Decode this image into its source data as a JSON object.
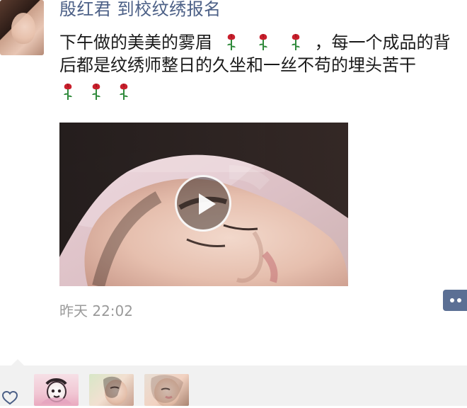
{
  "post": {
    "username": "殷红君 到校纹绣报名",
    "text_line1_before": "下午做的美美的雾眉",
    "text_line1_after": "，每一个成品的背",
    "text_line2": "后都是纹绣师整日的久坐和一丝不苟的埋头苦干",
    "emoji_name": "rose-emoji",
    "timestamp": "昨天 22:02"
  },
  "video": {
    "has_play_button": true
  },
  "likes": {
    "icon": "heart-icon",
    "avatars": [
      "liker-avatar-1",
      "liker-avatar-2",
      "liker-avatar-3"
    ]
  },
  "colors": {
    "username": "#4b5f86",
    "text": "#1a1a1a",
    "timestamp": "#9a9a9a",
    "likes_bg": "#f1f1f1",
    "more_button_bg": "#5b6f94",
    "rose_red": "#c91f2c",
    "rose_green": "#2f8a3b"
  }
}
